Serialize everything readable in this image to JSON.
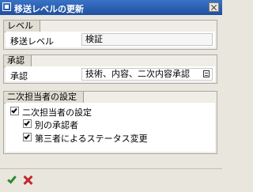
{
  "window": {
    "title": "移送レベルの更新"
  },
  "level_group": {
    "title": "レベル",
    "label": "移送レベル",
    "value": "検証"
  },
  "approval_group": {
    "title": "承認",
    "label": "承認",
    "value": "技術、内容、二次内容承認"
  },
  "secondary_group": {
    "title": "二次担当者の設定",
    "checkboxes": [
      {
        "label": "二次担当者の設定",
        "checked": true
      },
      {
        "label": "別の承認者",
        "checked": true
      },
      {
        "label": "第三者によるステータス変更",
        "checked": true
      }
    ]
  },
  "footer": {
    "ok": "ok-icon",
    "cancel": "cancel-icon"
  }
}
